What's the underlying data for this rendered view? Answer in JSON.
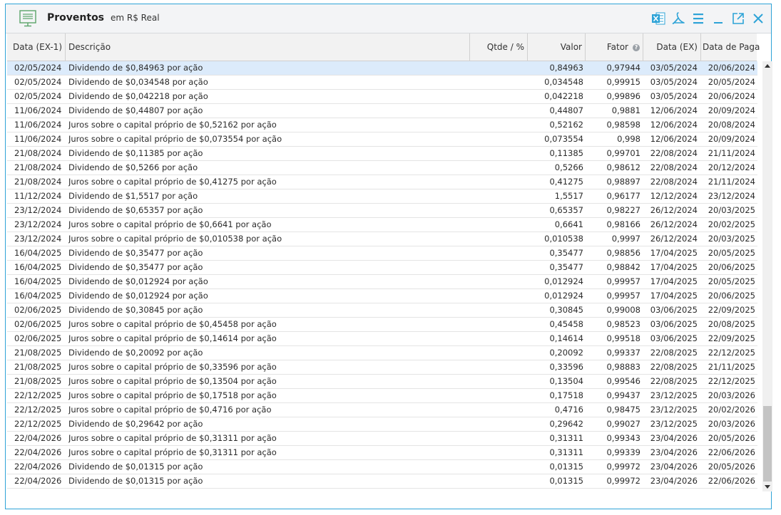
{
  "window": {
    "title": "Proventos",
    "subtitle": "em R$ Real",
    "toolbar_icons": [
      "excel-icon",
      "pdf-icon",
      "menu-icon",
      "minimize-icon",
      "popout-icon",
      "close-icon"
    ],
    "accent_color": "#2ea3d7"
  },
  "columns": {
    "data_ex1": "Data (EX-1)",
    "descricao": "Descrição",
    "qtde": "Qtde / %",
    "valor": "Valor",
    "fator": "Fator",
    "data_ex": "Data (EX)",
    "data_pag": "Data de Paga"
  },
  "rows": [
    {
      "data": "02/05/2024",
      "desc": "Dividendo de $0,84963 por ação",
      "valor": "0,84963",
      "fator": "0,97944",
      "dex": "03/05/2024",
      "dpag": "20/06/2024"
    },
    {
      "data": "02/05/2024",
      "desc": "Dividendo de $0,034548 por ação",
      "valor": "0,034548",
      "fator": "0,99915",
      "dex": "03/05/2024",
      "dpag": "20/05/2024"
    },
    {
      "data": "02/05/2024",
      "desc": "Dividendo de $0,042218 por ação",
      "valor": "0,042218",
      "fator": "0,99896",
      "dex": "03/05/2024",
      "dpag": "20/06/2024"
    },
    {
      "data": "11/06/2024",
      "desc": "Dividendo de $0,44807 por ação",
      "valor": "0,44807",
      "fator": "0,9881",
      "dex": "12/06/2024",
      "dpag": "20/09/2024"
    },
    {
      "data": "11/06/2024",
      "desc": "Juros sobre o capital próprio de $0,52162 por ação",
      "valor": "0,52162",
      "fator": "0,98598",
      "dex": "12/06/2024",
      "dpag": "20/08/2024"
    },
    {
      "data": "11/06/2024",
      "desc": "Juros sobre o capital próprio de $0,073554 por ação",
      "valor": "0,073554",
      "fator": "0,998",
      "dex": "12/06/2024",
      "dpag": "20/09/2024"
    },
    {
      "data": "21/08/2024",
      "desc": "Dividendo de $0,11385 por ação",
      "valor": "0,11385",
      "fator": "0,99701",
      "dex": "22/08/2024",
      "dpag": "21/11/2024"
    },
    {
      "data": "21/08/2024",
      "desc": "Dividendo de $0,5266 por ação",
      "valor": "0,5266",
      "fator": "0,98612",
      "dex": "22/08/2024",
      "dpag": "20/12/2024"
    },
    {
      "data": "21/08/2024",
      "desc": "Juros sobre o capital próprio de $0,41275 por ação",
      "valor": "0,41275",
      "fator": "0,98897",
      "dex": "22/08/2024",
      "dpag": "21/11/2024"
    },
    {
      "data": "11/12/2024",
      "desc": "Dividendo de $1,5517 por ação",
      "valor": "1,5517",
      "fator": "0,96177",
      "dex": "12/12/2024",
      "dpag": "23/12/2024"
    },
    {
      "data": "23/12/2024",
      "desc": "Dividendo de $0,65357 por ação",
      "valor": "0,65357",
      "fator": "0,98227",
      "dex": "26/12/2024",
      "dpag": "20/03/2025"
    },
    {
      "data": "23/12/2024",
      "desc": "Juros sobre o capital próprio de $0,6641 por ação",
      "valor": "0,6641",
      "fator": "0,98166",
      "dex": "26/12/2024",
      "dpag": "20/02/2025"
    },
    {
      "data": "23/12/2024",
      "desc": "Juros sobre o capital próprio de $0,010538 por ação",
      "valor": "0,010538",
      "fator": "0,9997",
      "dex": "26/12/2024",
      "dpag": "20/03/2025"
    },
    {
      "data": "16/04/2025",
      "desc": "Dividendo de $0,35477 por ação",
      "valor": "0,35477",
      "fator": "0,98856",
      "dex": "17/04/2025",
      "dpag": "20/05/2025"
    },
    {
      "data": "16/04/2025",
      "desc": "Dividendo de $0,35477 por ação",
      "valor": "0,35477",
      "fator": "0,98842",
      "dex": "17/04/2025",
      "dpag": "20/06/2025"
    },
    {
      "data": "16/04/2025",
      "desc": "Dividendo de $0,012924 por ação",
      "valor": "0,012924",
      "fator": "0,99957",
      "dex": "17/04/2025",
      "dpag": "20/05/2025"
    },
    {
      "data": "16/04/2025",
      "desc": "Dividendo de $0,012924 por ação",
      "valor": "0,012924",
      "fator": "0,99957",
      "dex": "17/04/2025",
      "dpag": "20/06/2025"
    },
    {
      "data": "02/06/2025",
      "desc": "Dividendo de $0,30845 por ação",
      "valor": "0,30845",
      "fator": "0,99008",
      "dex": "03/06/2025",
      "dpag": "22/09/2025"
    },
    {
      "data": "02/06/2025",
      "desc": "Juros sobre o capital próprio de $0,45458 por ação",
      "valor": "0,45458",
      "fator": "0,98523",
      "dex": "03/06/2025",
      "dpag": "20/08/2025"
    },
    {
      "data": "02/06/2025",
      "desc": "Juros sobre o capital próprio de $0,14614 por ação",
      "valor": "0,14614",
      "fator": "0,99518",
      "dex": "03/06/2025",
      "dpag": "22/09/2025"
    },
    {
      "data": "21/08/2025",
      "desc": "Dividendo de $0,20092 por ação",
      "valor": "0,20092",
      "fator": "0,99337",
      "dex": "22/08/2025",
      "dpag": "22/12/2025"
    },
    {
      "data": "21/08/2025",
      "desc": "Juros sobre o capital próprio de $0,33596 por ação",
      "valor": "0,33596",
      "fator": "0,98883",
      "dex": "22/08/2025",
      "dpag": "21/11/2025"
    },
    {
      "data": "21/08/2025",
      "desc": "Juros sobre o capital próprio de $0,13504 por ação",
      "valor": "0,13504",
      "fator": "0,99546",
      "dex": "22/08/2025",
      "dpag": "22/12/2025"
    },
    {
      "data": "22/12/2025",
      "desc": "Juros sobre o capital próprio de $0,17518 por ação",
      "valor": "0,17518",
      "fator": "0,99437",
      "dex": "23/12/2025",
      "dpag": "20/03/2026"
    },
    {
      "data": "22/12/2025",
      "desc": "Juros sobre o capital próprio de $0,4716 por ação",
      "valor": "0,4716",
      "fator": "0,98475",
      "dex": "23/12/2025",
      "dpag": "20/02/2026"
    },
    {
      "data": "22/12/2025",
      "desc": "Dividendo de $0,29642 por ação",
      "valor": "0,29642",
      "fator": "0,99027",
      "dex": "23/12/2025",
      "dpag": "20/03/2026"
    },
    {
      "data": "22/04/2026",
      "desc": "Juros sobre o capital próprio de $0,31311 por ação",
      "valor": "0,31311",
      "fator": "0,99343",
      "dex": "23/04/2026",
      "dpag": "20/05/2026"
    },
    {
      "data": "22/04/2026",
      "desc": "Juros sobre o capital próprio de $0,31311 por ação",
      "valor": "0,31311",
      "fator": "0,99339",
      "dex": "23/04/2026",
      "dpag": "22/06/2026"
    },
    {
      "data": "22/04/2026",
      "desc": "Dividendo de $0,01315 por ação",
      "valor": "0,01315",
      "fator": "0,99972",
      "dex": "23/04/2026",
      "dpag": "20/05/2026"
    },
    {
      "data": "22/04/2026",
      "desc": "Dividendo de $0,01315 por ação",
      "valor": "0,01315",
      "fator": "0,99972",
      "dex": "23/04/2026",
      "dpag": "22/06/2026"
    }
  ]
}
